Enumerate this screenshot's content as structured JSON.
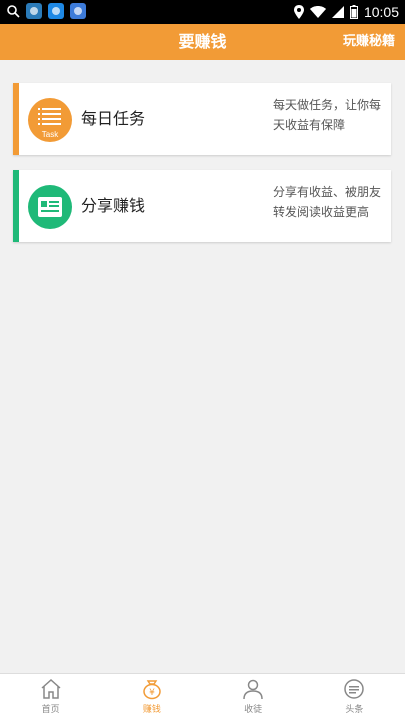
{
  "status_bar": {
    "time": "10:05"
  },
  "header": {
    "title": "要赚钱",
    "action": "玩赚秘籍"
  },
  "cards": [
    {
      "title": "每日任务",
      "description": "每天做任务，让你每天收益有保障",
      "icon_text": "Task",
      "accent_color": "#f29b36",
      "icon_color": "#f29b36"
    },
    {
      "title": "分享赚钱",
      "description": "分享有收益、被朋友转发阅读收益更高",
      "accent_color": "#1fb978",
      "icon_color": "#1fb978"
    }
  ],
  "bottom_nav": [
    {
      "label": "首页",
      "icon": "home-icon"
    },
    {
      "label": "赚钱",
      "icon": "money-bag-icon",
      "active": true
    },
    {
      "label": "收徒",
      "icon": "user-icon"
    },
    {
      "label": "头条",
      "icon": "headline-icon"
    }
  ],
  "colors": {
    "brand": "#f29b36",
    "green": "#1fb978"
  }
}
